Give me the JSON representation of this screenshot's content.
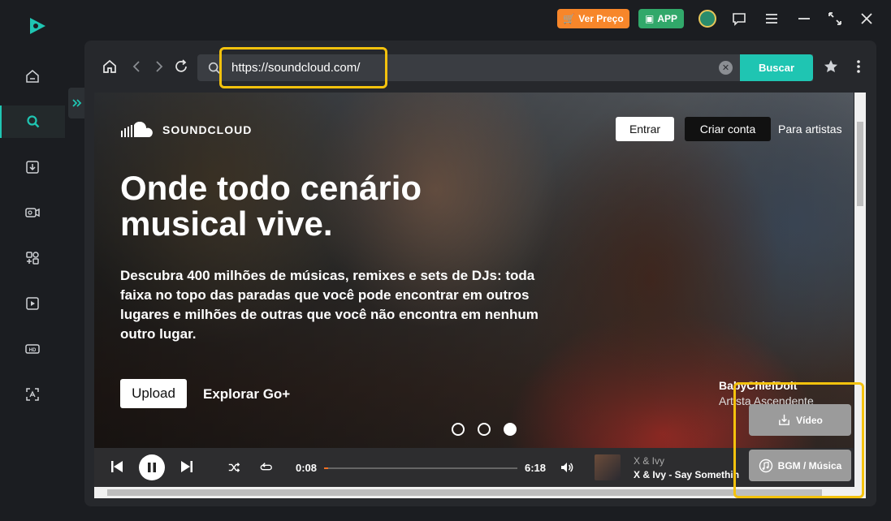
{
  "topbar": {
    "ver_preco_label": "Ver Preço",
    "app_label": "APP"
  },
  "sidebar": {
    "items": [
      {
        "name": "home",
        "icon": "home-icon"
      },
      {
        "name": "search",
        "icon": "search-icon",
        "active": true
      },
      {
        "name": "download",
        "icon": "download-icon"
      },
      {
        "name": "video-convert",
        "icon": "video-convert-icon"
      },
      {
        "name": "tools",
        "icon": "tools-icon"
      },
      {
        "name": "video-edit",
        "icon": "video-edit-icon"
      },
      {
        "name": "hd",
        "icon": "hd-icon"
      },
      {
        "name": "ai-scan",
        "icon": "ai-scan-icon"
      }
    ]
  },
  "browser": {
    "url": "https://soundcloud.com/",
    "search_button": "Buscar"
  },
  "page": {
    "brand": "SOUNDCLOUD",
    "entrar": "Entrar",
    "criar_conta": "Criar conta",
    "para_artistas": "Para artistas",
    "headline": "Onde todo cenário musical vive.",
    "subline": "Descubra 400 milhões de músicas, remixes e sets de DJs: toda faixa no topo das paradas que você pode encontrar em outros lugares e milhões de outras que você não encontra em nenhum outro lugar.",
    "upload": "Upload",
    "explorar": "Explorar Go+",
    "artist_name": "BabyChiefDoit",
    "artist_tag": "Artista Ascendente"
  },
  "player": {
    "time_current": "0:08",
    "time_total": "6:18",
    "progress": 0.02,
    "artist": "X & Ivy",
    "track": "X & Ivy - Say Something"
  },
  "float_buttons": {
    "video": "Vídeo",
    "bgm": "BGM / Música"
  },
  "colors": {
    "accent": "#1fc5b2",
    "price": "#f7862a",
    "app": "#31a86a",
    "highlight": "#f4c20d"
  }
}
